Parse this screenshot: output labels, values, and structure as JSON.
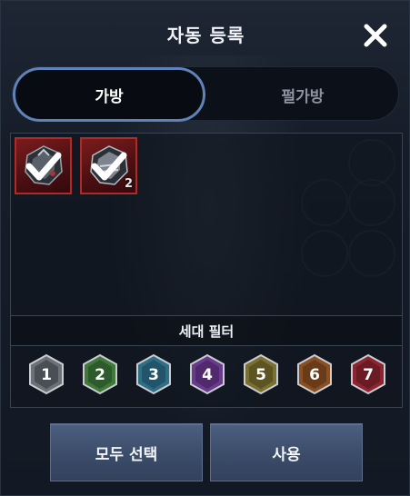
{
  "dialog": {
    "title": "자동 등록"
  },
  "tabs": [
    {
      "label": "가방",
      "active": true
    },
    {
      "label": "펄가방",
      "active": false
    }
  ],
  "inventory": {
    "items": [
      {
        "icon": "armor-item-icon",
        "checked": true,
        "count": ""
      },
      {
        "icon": "armor-item-icon",
        "checked": true,
        "count": "2"
      }
    ]
  },
  "filter": {
    "label": "세대 필터",
    "generations": [
      {
        "label": "1",
        "color": "#6d7177"
      },
      {
        "label": "2",
        "color": "#3f7a3a"
      },
      {
        "label": "3",
        "color": "#2f6f86"
      },
      {
        "label": "4",
        "color": "#6a3a8c"
      },
      {
        "label": "5",
        "color": "#7a7030"
      },
      {
        "label": "6",
        "color": "#8a4f22"
      },
      {
        "label": "7",
        "color": "#8c2530"
      }
    ]
  },
  "buttons": {
    "select_all": "모두 선택",
    "use": "사용"
  },
  "colors": {
    "tab_border": "#5f83b8",
    "slot_border": "#b02a2a",
    "button": "#3b4c69"
  }
}
